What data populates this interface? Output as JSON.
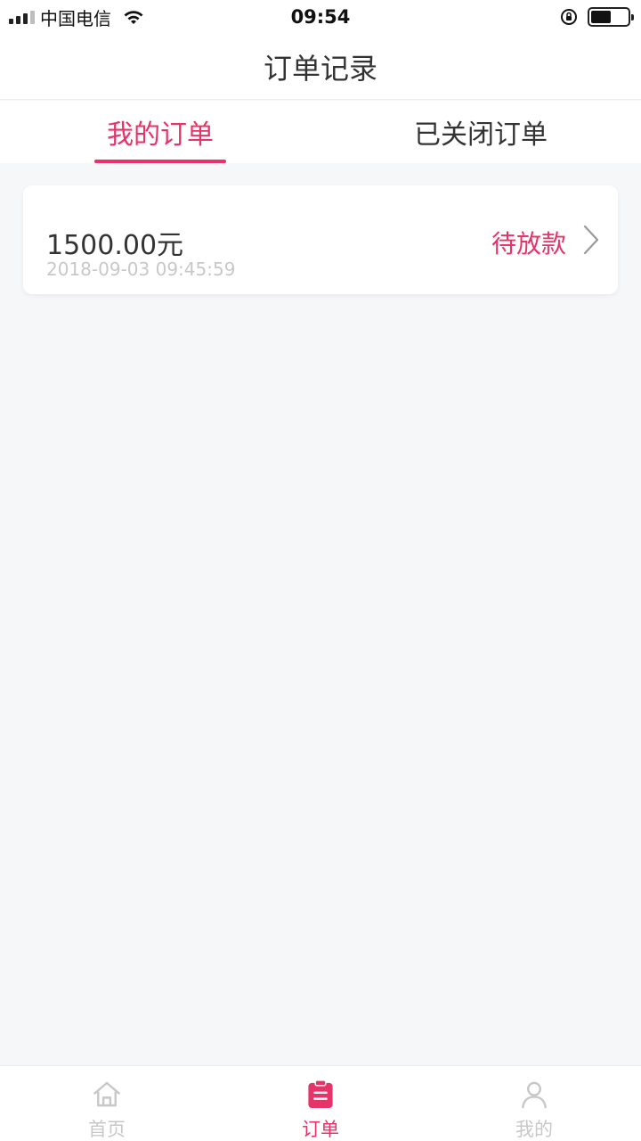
{
  "status_bar": {
    "carrier": "中国电信",
    "time": "09:54",
    "battery_level": 0.55
  },
  "nav": {
    "title": "订单记录"
  },
  "tabs": [
    {
      "label": "我的订单",
      "active": true
    },
    {
      "label": "已关闭订单",
      "active": false
    }
  ],
  "orders": [
    {
      "amount": "1500.00元",
      "time": "2018-09-03 09:45:59",
      "status": "待放款"
    }
  ],
  "tab_bar": [
    {
      "label": "首页",
      "icon": "home-icon",
      "active": false
    },
    {
      "label": "订单",
      "icon": "order-icon",
      "active": true
    },
    {
      "label": "我的",
      "icon": "user-icon",
      "active": false
    }
  ],
  "colors": {
    "accent": "#e6336a",
    "background": "#f6f7f9",
    "muted": "#c8c8c8"
  }
}
